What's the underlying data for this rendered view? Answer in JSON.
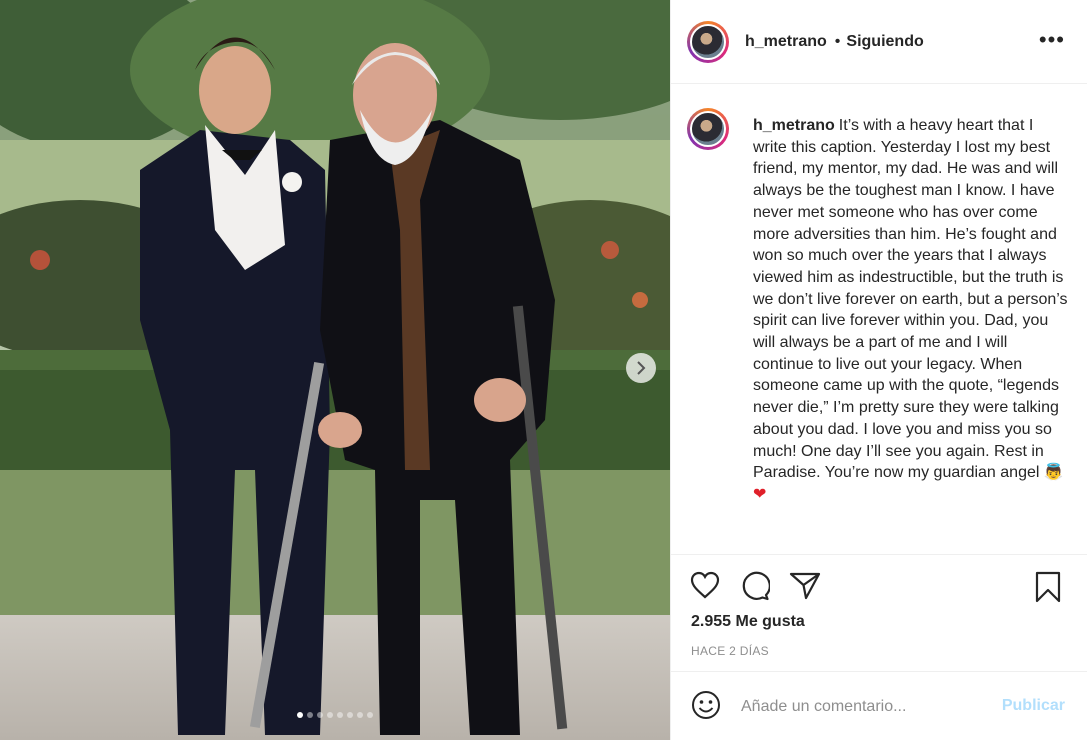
{
  "post": {
    "username": "h_metrano",
    "separator": "•",
    "follow_status": "Siguiendo",
    "more_label": "•••",
    "caption": "It’s with a heavy heart that I write this caption. Yesterday I lost my best friend, my mentor, my dad. He was and will always be the toughest man I know. I have never met someone who has over come more adversities than him. He’s fought and won so much over the years that I always viewed him as indestructible, but the truth is we don’t live forever on earth, but a person’s spirit can live forever within you. Dad, you will always be a part of me and I will continue to live out your legacy. When someone came up with the quote, “legends never die,” I’m pretty sure they were talking about you dad. I love you and miss you so much! One day I’ll see you again. Rest in Paradise. You’re now my guardian angel",
    "caption_emojis": [
      "👼",
      "❤"
    ],
    "likes": "2.955 Me gusta",
    "date": "HACE 2 DÍAS",
    "comment_placeholder": "Añade un comentario...",
    "publish_label": "Publicar"
  },
  "carousel": {
    "total_slides": 8,
    "current_slide": 1
  },
  "icons": [
    "heart-icon",
    "comment-icon",
    "share-icon",
    "bookmark-icon",
    "emoji-icon",
    "chevron-right-icon",
    "more-icon"
  ],
  "colors": {
    "text": "#262626",
    "muted": "#8e8e8e",
    "publish_disabled": "#b2dffc",
    "border": "#efefef"
  }
}
